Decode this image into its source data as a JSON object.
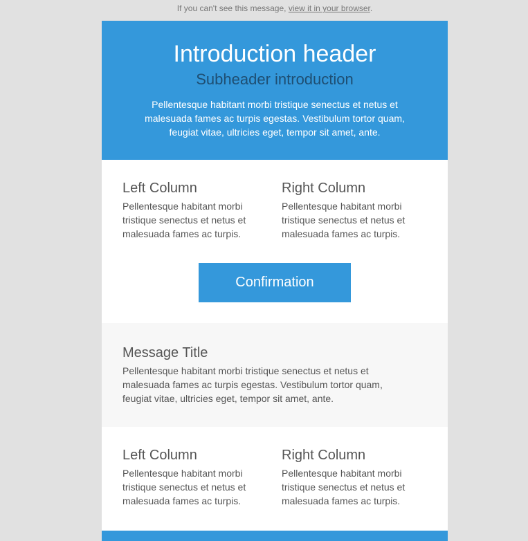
{
  "preheader": {
    "text": "If you can't see this message,",
    "link_text": "view it in your browser",
    "trailing": "."
  },
  "hero": {
    "title": "Introduction header",
    "subtitle": "Subheader introduction",
    "body": "Pellentesque habitant morbi tristique senectus et netus et malesuada fames ac turpis egestas. Vestibulum tortor quam, feugiat vitae, ultricies eget, tempor sit amet, ante."
  },
  "section1": {
    "left": {
      "title": "Left Column",
      "body": "Pellentesque habitant morbi tristique senectus et netus et malesuada fames ac turpis."
    },
    "right": {
      "title": "Right Column",
      "body": "Pellentesque habitant morbi tristique senectus et netus et malesuada fames ac turpis."
    },
    "button_label": "Confirmation"
  },
  "message": {
    "title": "Message Title",
    "body": "Pellentesque habitant morbi tristique senectus et netus et malesuada fames ac turpis egestas. Vestibulum tortor quam, feugiat vitae, ultricies eget, tempor sit amet, ante."
  },
  "section2": {
    "left": {
      "title": "Left Column",
      "body": "Pellentesque habitant morbi tristique senectus et netus et malesuada fames ac turpis."
    },
    "right": {
      "title": "Right Column",
      "body": "Pellentesque habitant morbi tristique senectus et netus et malesuada fames ac turpis."
    }
  },
  "colors": {
    "accent": "#3498db",
    "background": "#e1e1e1",
    "text": "#555555",
    "subheader": "#1e4e72",
    "gray_block": "#f7f7f7"
  }
}
